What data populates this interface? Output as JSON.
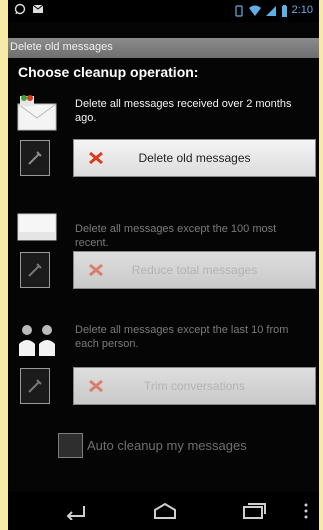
{
  "status_bar": {
    "time": "2:10",
    "left_icons": [
      "whatsapp-icon",
      "message-icon"
    ],
    "right_icons": [
      "vibrate-icon",
      "wifi-icon",
      "signal-icon",
      "battery-icon"
    ]
  },
  "title_bar": {
    "title": "Delete old messages"
  },
  "heading": "Choose cleanup operation:",
  "options": [
    {
      "description": "Delete all messages received over 2 months ago.",
      "button_label": "Delete old messages",
      "enabled": true,
      "icon": "calendar-envelope-icon"
    },
    {
      "description": "Delete all messages except the 100 most recent.",
      "button_label": "Reduce total messages",
      "enabled": false,
      "icon": "envelope-stack-icon"
    },
    {
      "description": "Delete all messages except the last 10 from each person.",
      "button_label": "Trim conversations",
      "enabled": false,
      "icon": "people-icon"
    }
  ],
  "auto_cleanup": {
    "label": "Auto cleanup my messages",
    "checked": false
  },
  "nav_bar": {
    "items": [
      "back-icon",
      "home-icon",
      "recents-icon",
      "menu-icon"
    ]
  },
  "colors": {
    "background": "#f7e9a8",
    "screen": "#050505",
    "clock": "#5fb0e6",
    "delete_mark": "#d93b1c"
  }
}
